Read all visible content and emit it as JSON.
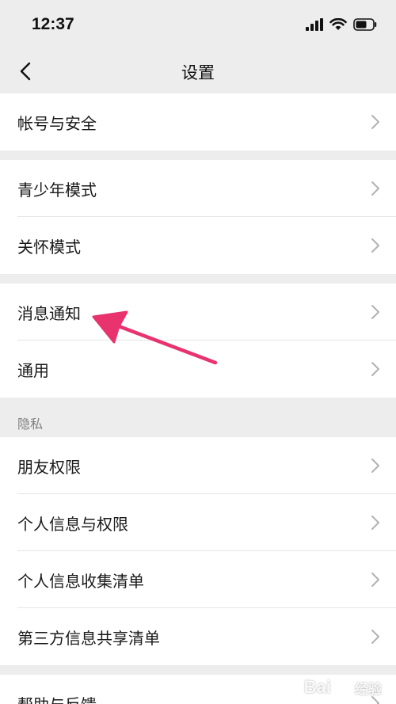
{
  "status_bar": {
    "time": "12:37",
    "icons": [
      "signal-icon",
      "wifi-icon",
      "battery-icon"
    ]
  },
  "nav": {
    "title": "设置",
    "back_icon": "chevron-left-icon"
  },
  "groups": [
    {
      "items": [
        {
          "label": "帐号与安全"
        }
      ]
    },
    {
      "items": [
        {
          "label": "青少年模式"
        },
        {
          "label": "关怀模式"
        }
      ]
    },
    {
      "items": [
        {
          "label": "消息通知"
        },
        {
          "label": "通用"
        }
      ]
    },
    {
      "section_label": "隐私",
      "items": [
        {
          "label": "朋友权限"
        },
        {
          "label": "个人信息与权限"
        },
        {
          "label": "个人信息收集清单"
        },
        {
          "label": "第三方信息共享清单"
        }
      ]
    },
    {
      "items": [
        {
          "label": "帮助与反馈"
        }
      ]
    }
  ],
  "watermark": {
    "brand": "Bai",
    "suffix": "经验"
  },
  "colors": {
    "background": "#ededed",
    "row_background": "#ffffff",
    "annotation_arrow": "#e8336f",
    "chevron": "#b2b2b2"
  }
}
